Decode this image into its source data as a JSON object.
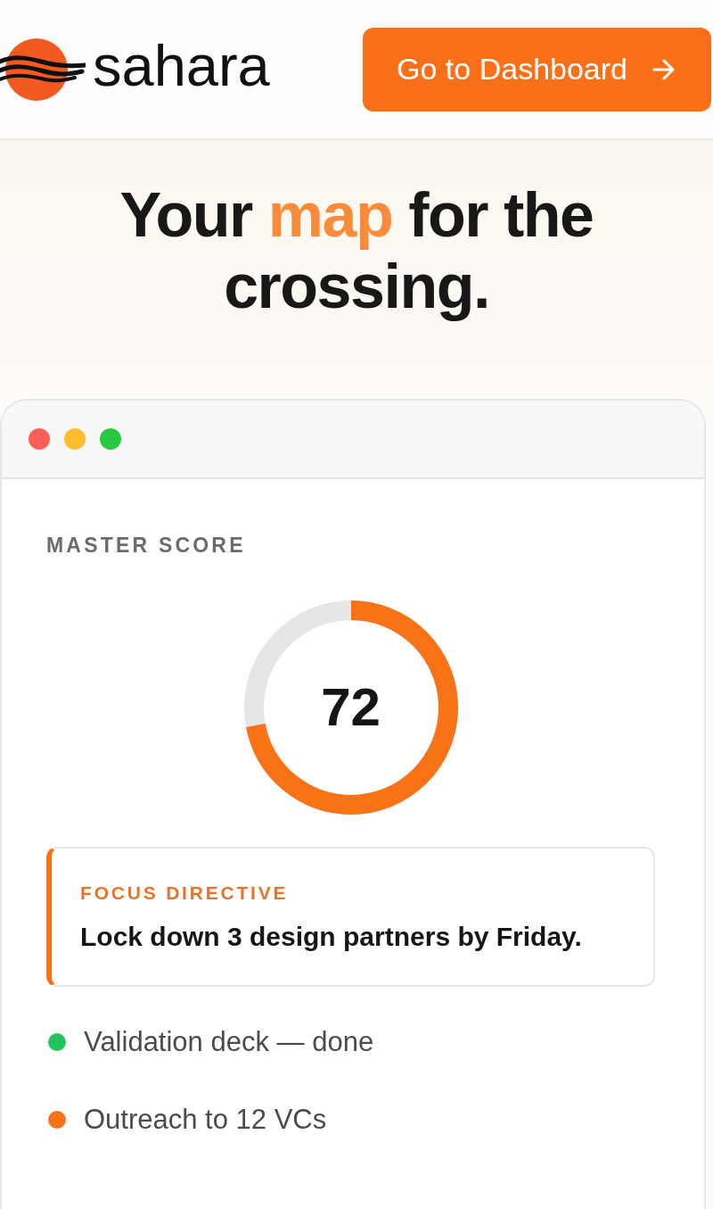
{
  "header": {
    "brand": "sahara",
    "button": {
      "label": "Go to Dashboard"
    }
  },
  "hero": {
    "headline": [
      {
        "text": "Your",
        "accent": false
      },
      {
        "text": "map",
        "accent": true
      },
      {
        "text": "for the crossing.",
        "accent": false
      }
    ]
  },
  "window": {
    "score": {
      "label": "MASTER SCORE",
      "value": "72",
      "level": 0.72
    },
    "focus": {
      "label": "FOCUS DIRECTIVE",
      "text": "Lock down 3 design partners by Friday."
    },
    "tasks": [
      {
        "text": "Validation deck — done",
        "color": "#22c55e"
      },
      {
        "text": "Outreach to 12 VCs",
        "color": "#f97316"
      }
    ]
  }
}
